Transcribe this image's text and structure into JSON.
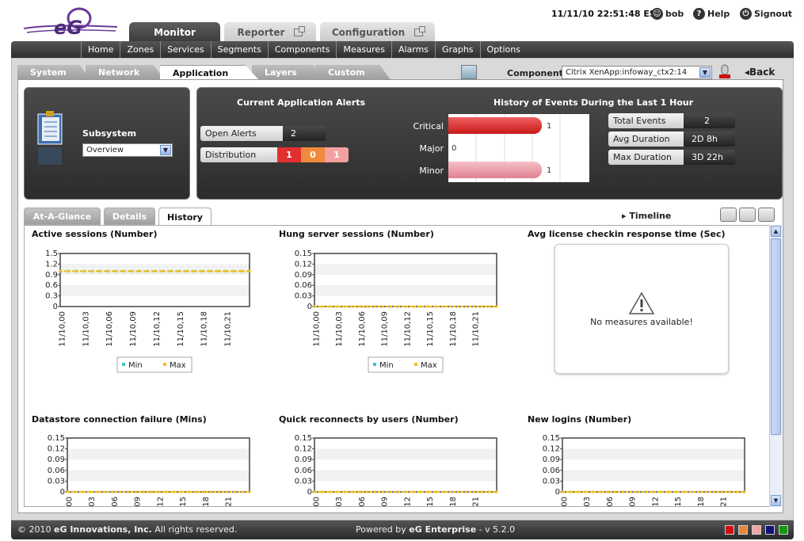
{
  "header": {
    "datetime": "11/11/10 22:51:48 EST",
    "user": "bob",
    "help": "Help",
    "signout": "Signout",
    "logo_text": "eG"
  },
  "main_tabs": {
    "monitor": "Monitor",
    "reporter": "Reporter",
    "configuration": "Configuration"
  },
  "nav": [
    "Home",
    "Zones",
    "Services",
    "Segments",
    "Components",
    "Measures",
    "Alarms",
    "Graphs",
    "Options"
  ],
  "sub_tabs": [
    "System",
    "Network",
    "Application",
    "Layers",
    "Custom"
  ],
  "component": {
    "label": "Component",
    "value": "Citrix XenApp:infoway_ctx2:14"
  },
  "back": "Back",
  "subsystem": {
    "label": "Subsystem",
    "value": "Overview"
  },
  "alerts": {
    "title": "Current Application Alerts",
    "open_label": "Open Alerts",
    "open_value": "2",
    "dist_label": "Distribution",
    "dist": [
      {
        "value": "1",
        "color": "#e03030"
      },
      {
        "value": "0",
        "color": "#f08a3c"
      },
      {
        "value": "1",
        "color": "#f3a0a0"
      }
    ]
  },
  "history": {
    "title": "History of Events During the Last 1 Hour",
    "rows": [
      {
        "label": "Critical",
        "value": 1,
        "color": "#e02828"
      },
      {
        "label": "Major",
        "value": 0,
        "color": "#f08a3c"
      },
      {
        "label": "Minor",
        "value": 1,
        "color": "#f0a8b0"
      }
    ]
  },
  "stats": [
    {
      "label": "Total Events",
      "value": "2"
    },
    {
      "label": "Avg Duration",
      "value": "2D 8h"
    },
    {
      "label": "Max Duration",
      "value": "3D 22h"
    }
  ],
  "view_tabs": [
    "At-A-Glance",
    "Details",
    "History"
  ],
  "timeline": "Timeline",
  "no_measures": "No measures available!",
  "legend": {
    "min": "Min",
    "max": "Max"
  },
  "chart_data": [
    {
      "type": "line",
      "title": "Active sessions (Number)",
      "x": [
        "11/10,00",
        "11/10,03",
        "11/10,06",
        "11/10,09",
        "11/10,12",
        "11/10,15",
        "11/10,18",
        "11/10,21"
      ],
      "yticks": [
        "1.5",
        "1.2",
        "0.9",
        "0.6",
        "0.3",
        "0"
      ],
      "ylim": [
        0,
        1.5
      ],
      "series": [
        {
          "name": "Min",
          "values": [
            1,
            1,
            1,
            1,
            1,
            1,
            1,
            1
          ]
        },
        {
          "name": "Max",
          "values": [
            1,
            1,
            1,
            1,
            1,
            1,
            1,
            1
          ]
        }
      ],
      "legend": "bottom"
    },
    {
      "type": "line",
      "title": "Hung server sessions (Number)",
      "x": [
        "11/10,00",
        "11/10,03",
        "11/10,06",
        "11/10,09",
        "11/10,12",
        "11/10,15",
        "11/10,18",
        "11/10,21"
      ],
      "yticks": [
        "0.15",
        "0.12",
        "0.09",
        "0.06",
        "0.03",
        "0"
      ],
      "ylim": [
        0,
        0.15
      ],
      "series": [
        {
          "name": "Min",
          "values": [
            0,
            0,
            0,
            0,
            0,
            0,
            0,
            0
          ]
        },
        {
          "name": "Max",
          "values": [
            0,
            0,
            0,
            0,
            0,
            0,
            0,
            0
          ]
        }
      ],
      "legend": "bottom"
    },
    {
      "type": "line",
      "title": "Avg license checkin response time (Sec)",
      "x": [],
      "series": []
    },
    {
      "type": "line",
      "title": "Datastore connection failure (Mins)",
      "x": [
        "00",
        "03",
        "06",
        "09",
        "12",
        "15",
        "18",
        "21"
      ],
      "yticks": [
        "0.15",
        "0.12",
        "0.09",
        "0.06",
        "0.03",
        "0"
      ],
      "ylim": [
        0,
        0.15
      ],
      "series": [
        {
          "name": "Max",
          "values": [
            0,
            0,
            0,
            0,
            0,
            0,
            0,
            0
          ]
        }
      ]
    },
    {
      "type": "line",
      "title": "Quick reconnects by users (Number)",
      "x": [
        "00",
        "03",
        "06",
        "09",
        "12",
        "15",
        "18",
        "21"
      ],
      "yticks": [
        "0.15",
        "0.12",
        "0.09",
        "0.06",
        "0.03",
        "0"
      ],
      "ylim": [
        0,
        0.15
      ],
      "series": [
        {
          "name": "Max",
          "values": [
            0,
            0,
            0,
            0,
            0,
            0,
            0,
            0
          ]
        }
      ]
    },
    {
      "type": "line",
      "title": "New logins (Number)",
      "x": [
        "00",
        "03",
        "06",
        "09",
        "12",
        "15",
        "18",
        "21"
      ],
      "yticks": [
        "0.15",
        "0.12",
        "0.09",
        "0.06",
        "0.03",
        "0"
      ],
      "ylim": [
        0,
        0.15
      ],
      "series": [
        {
          "name": "Max",
          "values": [
            0,
            0,
            0,
            0,
            0,
            0,
            0,
            0
          ]
        }
      ]
    }
  ],
  "footer": {
    "copyright": "© 2010",
    "company": "eG Innovations, Inc.",
    "rights": "All rights reserved.",
    "powered": "Powered by",
    "product": "eG Enterprise",
    "version": "- v 5.2.0",
    "squares": [
      "#cc1111",
      "#e8863a",
      "#f3a3a3",
      "#11117a",
      "#119911"
    ]
  }
}
